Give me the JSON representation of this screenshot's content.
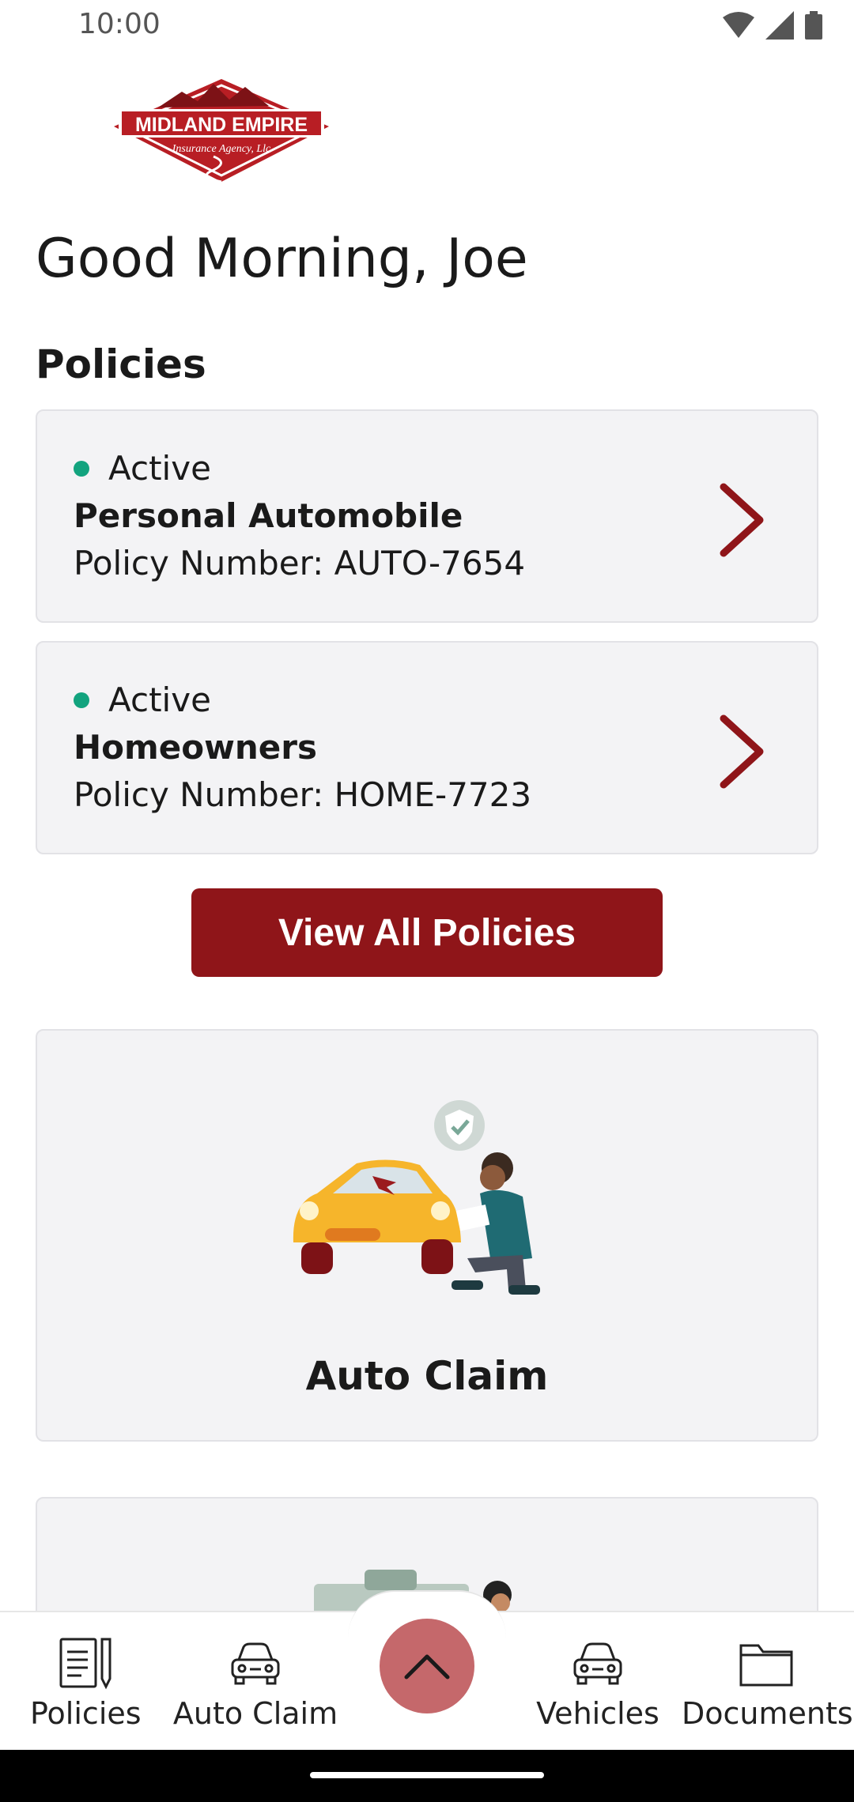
{
  "status_bar": {
    "time": "10:00",
    "icons": [
      "wifi-icon",
      "signal-icon",
      "battery-icon"
    ]
  },
  "logo": {
    "line1": "MIDLAND EMPIRE",
    "line2": "Insurance Agency, Llc",
    "color": "#b81e24"
  },
  "greeting": "Good Morning, Joe",
  "policies_section": {
    "title": "Policies",
    "items": [
      {
        "status": "Active",
        "name": "Personal Automobile",
        "number": "Policy Number: AUTO-7654"
      },
      {
        "status": "Active",
        "name": "Homeowners",
        "number": "Policy Number: HOME-7723"
      }
    ],
    "view_all_label": "View All Policies"
  },
  "claim_card": {
    "label": "Auto Claim",
    "illustration": "car-accident-illustration"
  },
  "bottom_nav": {
    "items": [
      {
        "label": "Policies",
        "icon": "policy-document-icon"
      },
      {
        "label": "Auto Claim",
        "icon": "car-icon"
      },
      {
        "label": "Vehicles",
        "icon": "car-icon"
      },
      {
        "label": "Documents",
        "icon": "folder-icon"
      }
    ],
    "fab_icon": "chevron-up-icon"
  },
  "colors": {
    "brand_red": "#8f1519",
    "active_dot": "#12a37e",
    "fab": "#c5686b",
    "card_bg": "#f3f3f5"
  }
}
